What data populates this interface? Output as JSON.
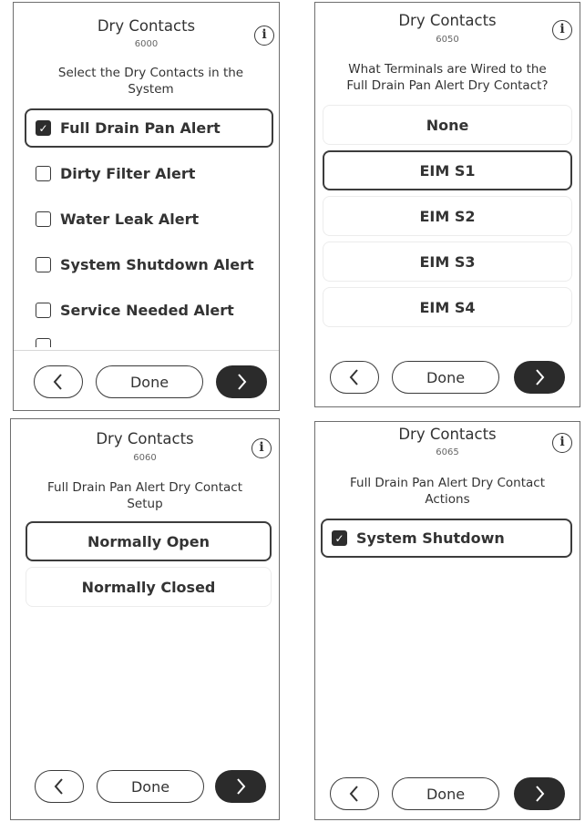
{
  "screens": [
    {
      "title": "Dry Contacts",
      "code": "6000",
      "question": "Select the Dry Contacts in the System",
      "items": [
        {
          "label": "Full Drain Pan Alert",
          "checked": true,
          "selected": true
        },
        {
          "label": "Dirty Filter Alert",
          "checked": false,
          "selected": false
        },
        {
          "label": "Water Leak Alert",
          "checked": false,
          "selected": false
        },
        {
          "label": "System Shutdown Alert",
          "checked": false,
          "selected": false
        },
        {
          "label": "Service Needed Alert",
          "checked": false,
          "selected": false
        }
      ],
      "done_label": "Done"
    },
    {
      "title": "Dry Contacts",
      "code": "6050",
      "question_lines": [
        "What Terminals are Wired to the",
        "Full Drain Pan Alert Dry Contact?"
      ],
      "options": [
        {
          "label": "None",
          "selected": false
        },
        {
          "label": "EIM S1",
          "selected": true
        },
        {
          "label": "EIM S2",
          "selected": false
        },
        {
          "label": "EIM S3",
          "selected": false
        },
        {
          "label": "EIM S4",
          "selected": false
        }
      ],
      "done_label": "Done"
    },
    {
      "title": "Dry Contacts",
      "code": "6060",
      "question_lines": [
        "Full Drain Pan Alert Dry Contact",
        "Setup"
      ],
      "options": [
        {
          "label": "Normally Open",
          "selected": true
        },
        {
          "label": "Normally Closed",
          "selected": false
        }
      ],
      "done_label": "Done"
    },
    {
      "title": "Dry Contacts",
      "code": "6065",
      "question_lines": [
        "Full Drain Pan Alert Dry Contact",
        "Actions"
      ],
      "items": [
        {
          "label": "System Shutdown",
          "checked": true,
          "selected": true
        }
      ],
      "done_label": "Done"
    }
  ],
  "icons": {
    "info": "info-icon",
    "prev": "chevron-left-icon",
    "next": "chevron-right-icon",
    "check": "checkmark-icon"
  },
  "colors": {
    "selected_border": "#3c3c3c",
    "next_button": "#2b2b2b",
    "frame": "#6e6e6e"
  }
}
